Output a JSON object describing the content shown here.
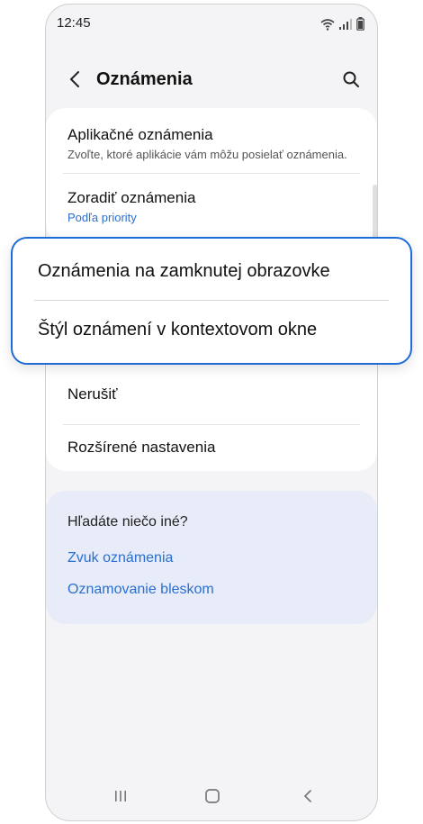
{
  "status_bar": {
    "time": "12:45"
  },
  "header": {
    "title": "Oznámenia"
  },
  "card1": {
    "items": [
      {
        "title": "Aplikačné oznámenia",
        "subtitle": "Zvoľte, ktoré aplikácie vám môžu posielať oznámenia."
      },
      {
        "title": "Zoradiť oznámenia",
        "subtitle": "Podľa priority"
      }
    ]
  },
  "popup": {
    "options": [
      "Oznámenia na zamknutej obrazovke",
      "Štýl oznámení v kontextovom okne"
    ]
  },
  "card2": {
    "items": [
      {
        "title": "Nerušiť"
      },
      {
        "title": "Rozšírené nastavenia"
      }
    ]
  },
  "suggestions": {
    "question": "Hľadáte niečo iné?",
    "links": [
      "Zvuk oznámenia",
      "Oznamovanie bleskom"
    ]
  },
  "colors": {
    "accent": "#1f6cd8",
    "link": "#2a6fd1",
    "background": "#f4f4f6"
  }
}
